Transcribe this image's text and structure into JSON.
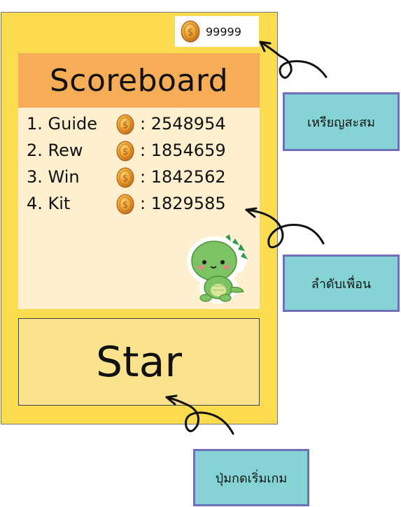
{
  "coins": {
    "icon": "dollar-coin-icon",
    "value": "99999"
  },
  "scoreboard": {
    "title": "Scoreboard",
    "entries": [
      {
        "name": "1. Guide",
        "score": ": 2548954"
      },
      {
        "name": "2. Rew",
        "score": ": 1854659"
      },
      {
        "name": "3. Win",
        "score": ": 1842562"
      },
      {
        "name": "4. Kit",
        "score": ": 1829585"
      }
    ],
    "mascot": "green-dinosaur-sticker"
  },
  "start_button": {
    "label": "Star"
  },
  "annotations": {
    "coins_note": "เหรียญสะสม",
    "friends_note": "ลำดับเพื่อน",
    "start_note": "ปุ่มกดเริ่มเกม"
  },
  "colors": {
    "screen_background": "#fbdc4e",
    "board_header": "#f6ad55",
    "board_body": "#fef0cf",
    "start_button": "#fbe28c",
    "note_fill": "#86d3d5",
    "note_border": "#6b70b8",
    "coin": "#e89a2a"
  }
}
